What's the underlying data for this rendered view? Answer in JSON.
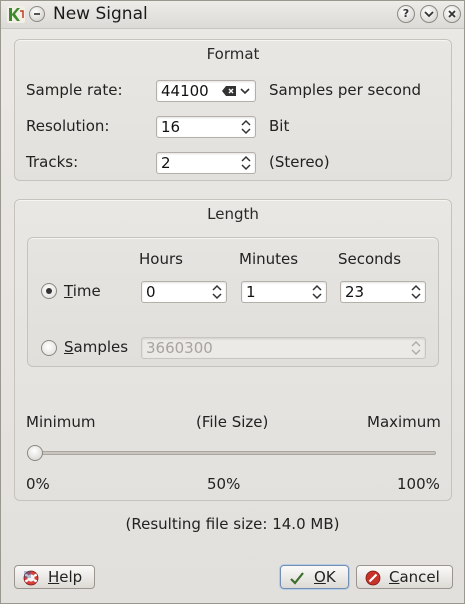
{
  "window": {
    "title": "New Signal",
    "titlebar_buttons": [
      "help-icon",
      "minimize-icon",
      "close-icon"
    ]
  },
  "format": {
    "title": "Format",
    "sample_rate": {
      "label": "Sample rate:",
      "value": "44100",
      "unit": "Samples per second"
    },
    "resolution": {
      "label": "Resolution:",
      "value": "16",
      "unit": "Bit"
    },
    "tracks": {
      "label": "Tracks:",
      "value": "2",
      "unit": "(Stereo)"
    }
  },
  "length": {
    "title": "Length",
    "columns": {
      "hours": "Hours",
      "minutes": "Minutes",
      "seconds": "Seconds"
    },
    "time": {
      "label_mnemonic": "T",
      "label_rest": "ime",
      "selected": true,
      "hours": "0",
      "minutes": "1",
      "seconds": "23"
    },
    "samples": {
      "label_mnemonic": "S",
      "label_rest": "amples",
      "selected": false,
      "value": "3660300"
    },
    "slider": {
      "min_label": "Minimum",
      "mid_label": "(File Size)",
      "max_label": "Maximum",
      "tick_min": "0%",
      "tick_mid": "50%",
      "tick_max": "100%",
      "value_percent": 0
    },
    "result": "(Resulting file size: 14.0 MB)"
  },
  "buttons": {
    "help": {
      "mnemonic": "H",
      "rest": "elp"
    },
    "ok": {
      "mnemonic": "O",
      "rest": "K"
    },
    "cancel": {
      "mnemonic": "C",
      "rest": "ancel"
    }
  },
  "colors": {
    "cancel_icon": "#c8322a",
    "ok_check": "#3a7a2a",
    "default_button_border": "#6f8fb4"
  }
}
